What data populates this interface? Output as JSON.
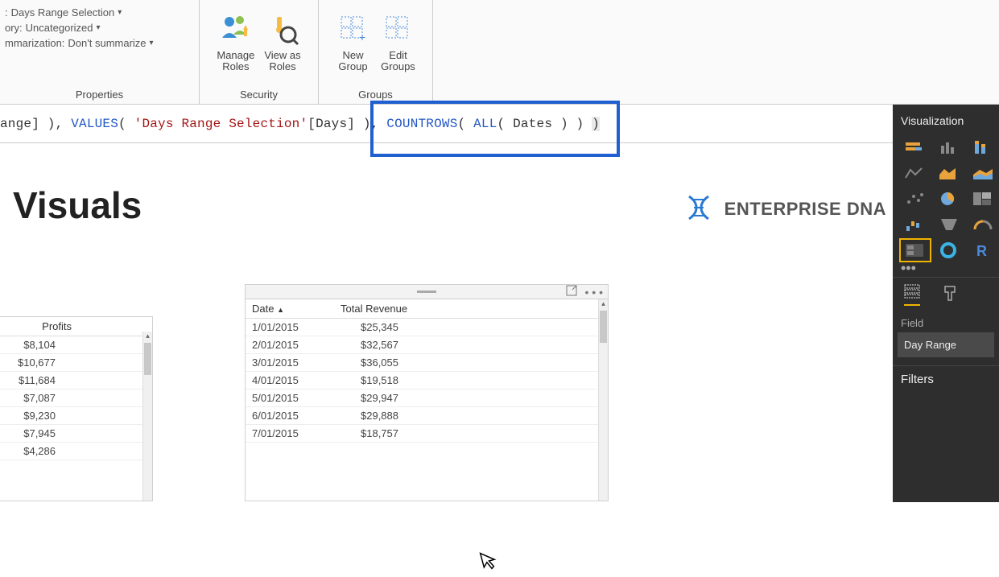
{
  "ribbon": {
    "properties": {
      "line1_prefix": ": ",
      "line1_value": "Days Range Selection",
      "line2_prefix": "ory: ",
      "line2_value": "Uncategorized",
      "line3_prefix": "mmarization: ",
      "line3_value": "Don't summarize",
      "group_label": "Properties"
    },
    "security": {
      "manage_roles": "Manage\nRoles",
      "view_as_roles": "View as\nRoles",
      "group_label": "Security"
    },
    "groups": {
      "new_group": "New\nGroup",
      "edit_groups": "Edit\nGroups",
      "group_label": "Groups"
    }
  },
  "formula": {
    "p1": "ange] ), ",
    "fn1": "VALUES",
    "p2": "( ",
    "str1": "'Days Range Selection'",
    "p3": "[Days] ), ",
    "fn2": "COUNTROWS",
    "p4": "( ",
    "fn3": "ALL",
    "p5": "( Dates ) ) ",
    "p6": ")"
  },
  "page": {
    "title": "Visuals",
    "logo_text": "ENTERPRISE DNA"
  },
  "table_profits": {
    "col1": "Profits",
    "rows": [
      "$8,104",
      "$10,677",
      "$11,684",
      "$7,087",
      "$9,230",
      "$7,945",
      "$4,286"
    ]
  },
  "table_revenue": {
    "col1": "Date",
    "col2": "Total Revenue",
    "rows": [
      {
        "d": "1/01/2015",
        "v": "$25,345"
      },
      {
        "d": "2/01/2015",
        "v": "$32,567"
      },
      {
        "d": "3/01/2015",
        "v": "$36,055"
      },
      {
        "d": "4/01/2015",
        "v": "$19,518"
      },
      {
        "d": "5/01/2015",
        "v": "$29,947"
      },
      {
        "d": "6/01/2015",
        "v": "$29,888"
      },
      {
        "d": "7/01/2015",
        "v": "$18,757"
      }
    ]
  },
  "viz_panel": {
    "title": "Visualization",
    "field_label": "Field",
    "field_value": "Day Range",
    "filters_label": "Filters"
  }
}
